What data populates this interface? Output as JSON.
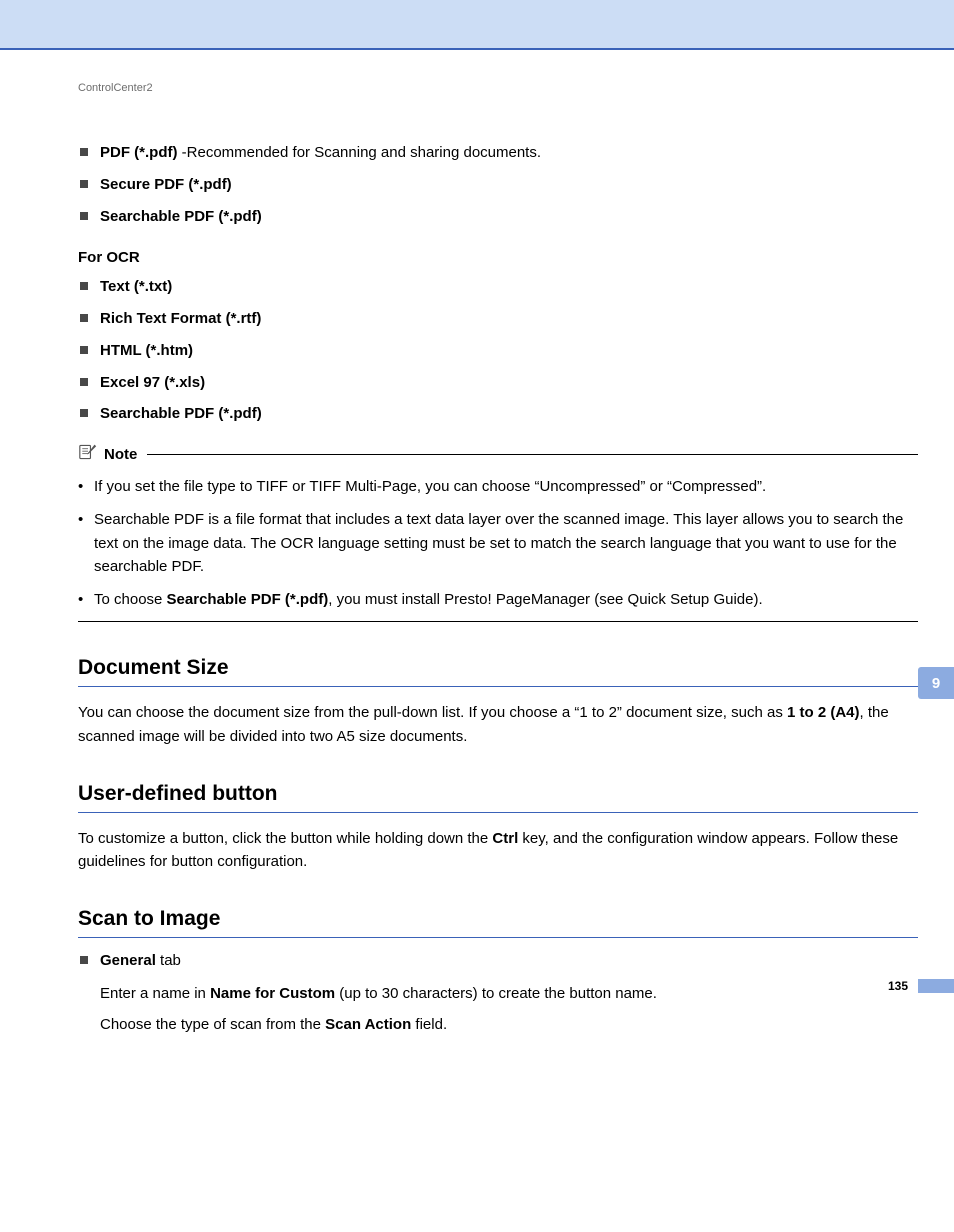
{
  "running_head": "ControlCenter2",
  "top_list": [
    {
      "bold": "PDF (*.pdf)",
      "rest": " -Recommended for Scanning and sharing documents."
    },
    {
      "bold": "Secure PDF (*.pdf)",
      "rest": ""
    },
    {
      "bold": "Searchable PDF (*.pdf)",
      "rest": ""
    }
  ],
  "ocr_label": "For OCR",
  "ocr_list": [
    {
      "bold": "Text (*.txt)",
      "rest": ""
    },
    {
      "bold": "Rich Text Format (*.rtf)",
      "rest": ""
    },
    {
      "bold": "HTML (*.htm)",
      "rest": ""
    },
    {
      "bold": "Excel 97 (*.xls)",
      "rest": ""
    },
    {
      "bold": "Searchable PDF (*.pdf)",
      "rest": ""
    }
  ],
  "note": {
    "label": "Note",
    "items": [
      {
        "runs": [
          {
            "t": "If you set the file type to TIFF or TIFF Multi-Page, you can choose “Uncompressed” or “Compressed”.",
            "b": false
          }
        ]
      },
      {
        "runs": [
          {
            "t": "Searchable PDF is a file format that includes a text data layer over the scanned image. This layer allows you to search the text on the image data. The OCR language setting must be set to match the search language that you want to use for the searchable PDF.",
            "b": false
          }
        ]
      },
      {
        "runs": [
          {
            "t": "To choose ",
            "b": false
          },
          {
            "t": "Searchable PDF (*.pdf)",
            "b": true
          },
          {
            "t": ", you must install Presto! PageManager (see Quick Setup Guide).",
            "b": false
          }
        ]
      }
    ]
  },
  "sections": {
    "doc_size": {
      "title": "Document Size",
      "marker": "9",
      "para_runs": [
        {
          "t": "You can choose the document size from the pull-down list. If you choose a “1 to 2” document size, such as ",
          "b": false
        },
        {
          "t": "1 to 2 (A4)",
          "b": true
        },
        {
          "t": ", the scanned image will be divided into two A5 size documents.",
          "b": false
        }
      ]
    },
    "user_btn": {
      "title": "User-defined button",
      "marker": "9",
      "para_runs": [
        {
          "t": "To customize a button, click the button while holding down the ",
          "b": false
        },
        {
          "t": "Ctrl",
          "b": true
        },
        {
          "t": " key, and the configuration window appears. Follow these guidelines for button configuration.",
          "b": false
        }
      ]
    },
    "scan_image": {
      "title": "Scan to Image",
      "marker": "9",
      "general_label": "General",
      "general_tab_word": " tab",
      "line1_runs": [
        {
          "t": "Enter a name in ",
          "b": false
        },
        {
          "t": "Name for Custom",
          "b": true
        },
        {
          "t": " (up to 30 characters) to create the button name.",
          "b": false
        }
      ],
      "line2_runs": [
        {
          "t": "Choose the type of scan from the ",
          "b": false
        },
        {
          "t": "Scan Action",
          "b": true
        },
        {
          "t": " field.",
          "b": false
        }
      ]
    }
  },
  "side_tab": "9",
  "page_number": "135"
}
